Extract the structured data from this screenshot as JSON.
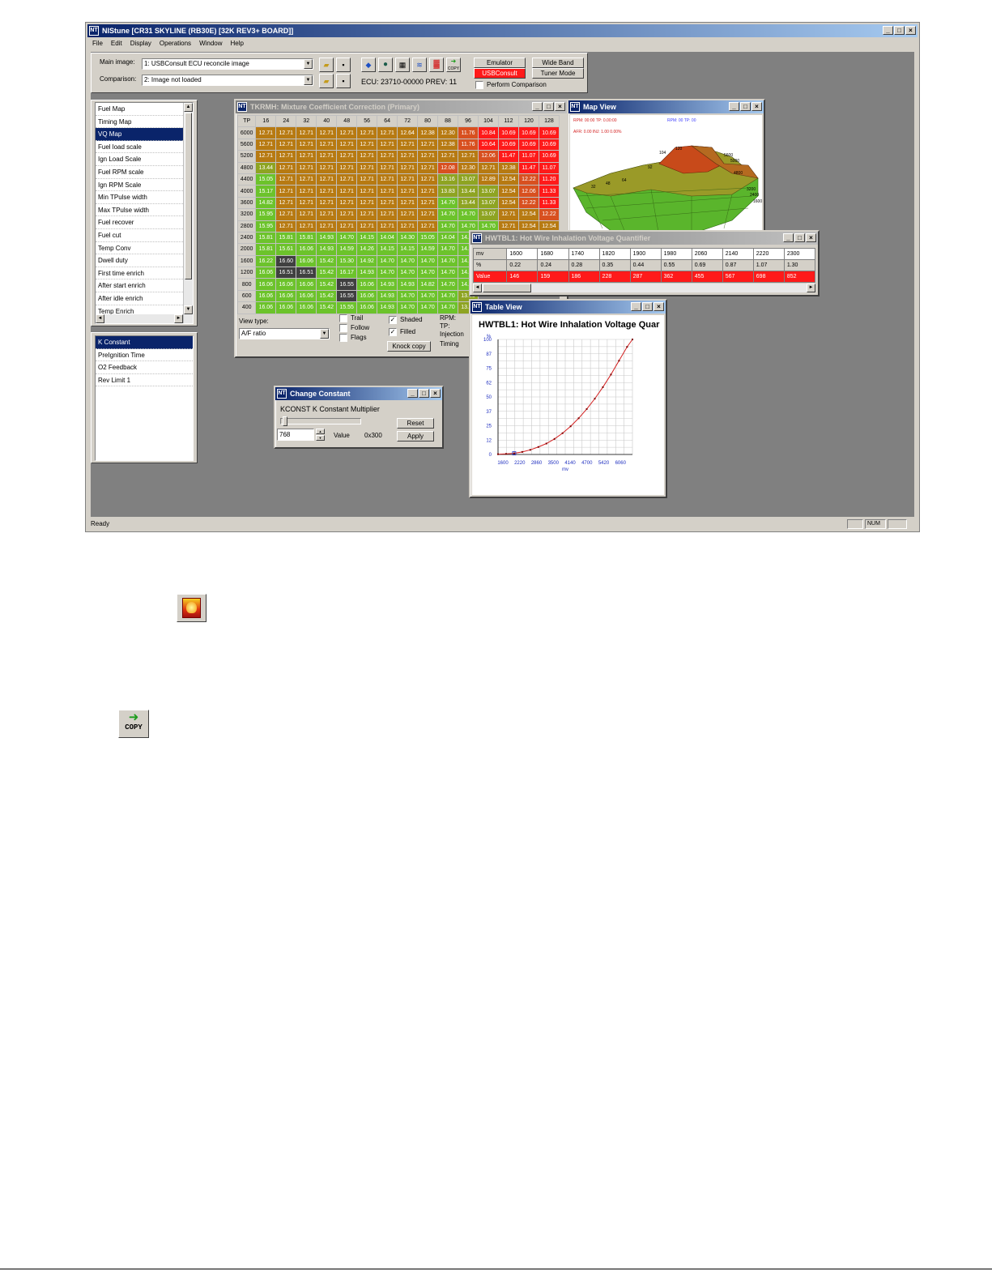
{
  "app": {
    "title": "NIStune [CR31 SKYLINE (RB30E) [32K REV3+ BOARD]]",
    "menu": [
      "File",
      "Edit",
      "Display",
      "Operations",
      "Window",
      "Help"
    ],
    "status": "Ready",
    "status_num": "NUM"
  },
  "toolbar": {
    "main_image_label": "Main image:",
    "main_image_value": "1: USBConsult ECU reconcile image",
    "comparison_label": "Comparison:",
    "comparison_value": "2: Image not loaded",
    "ecu_info": "ECU: 23710-00000 PREV: 11",
    "emulator": "Emulator",
    "usbconsult": "USBConsult",
    "wide_band": "Wide Band",
    "tuner_mode": "Tuner Mode",
    "perform_comparison": "Perform Comparison",
    "copy_label": "COPY"
  },
  "maps_list": [
    "Fuel Map",
    "Timing Map",
    "VQ Map",
    "Fuel load scale",
    "Ign Load Scale",
    "Fuel RPM scale",
    "Ign RPM Scale",
    "Min TPulse width",
    "Max TPulse width",
    "Fuel recover",
    "Fuel cut",
    "Temp Conv",
    "Dwell duty",
    "First time enrich",
    "After start enrich",
    "After idle enrich",
    "Temp Enrich"
  ],
  "maps_selected": 2,
  "constants_list": [
    "K Constant",
    "PreIgnition Time",
    "O2 Feedback",
    "Rev Limit 1"
  ],
  "constants_selected": 0,
  "tkrmh": {
    "title": "TKRMH: Mixture Coefficient Correction (Primary)",
    "corner": "TP",
    "cols": [
      "16",
      "24",
      "32",
      "40",
      "48",
      "56",
      "64",
      "72",
      "80",
      "88",
      "96",
      "104",
      "112",
      "120",
      "128"
    ],
    "rows": [
      {
        "rpm": "6000",
        "v": [
          "12.71",
          "12.71",
          "12.71",
          "12.71",
          "12.71",
          "12.71",
          "12.71",
          "12.64",
          "12.38",
          "12.30",
          "11.76",
          "10.84",
          "10.69",
          "10.69",
          "10.69"
        ]
      },
      {
        "rpm": "5600",
        "v": [
          "12.71",
          "12.71",
          "12.71",
          "12.71",
          "12.71",
          "12.71",
          "12.71",
          "12.71",
          "12.71",
          "12.38",
          "11.76",
          "10.64",
          "10.69",
          "10.69",
          "10.69"
        ]
      },
      {
        "rpm": "5200",
        "v": [
          "12.71",
          "12.71",
          "12.71",
          "12.71",
          "12.71",
          "12.71",
          "12.71",
          "12.71",
          "12.71",
          "12.71",
          "12.71",
          "12.06",
          "11.47",
          "11.07",
          "10.69"
        ]
      },
      {
        "rpm": "4800",
        "v": [
          "13.44",
          "12.71",
          "12.71",
          "12.71",
          "12.71",
          "12.71",
          "12.71",
          "12.71",
          "12.71",
          "12.08",
          "12.30",
          "12.71",
          "12.38",
          "11.47",
          "11.07"
        ]
      },
      {
        "rpm": "4400",
        "v": [
          "15.05",
          "12.71",
          "12.71",
          "12.71",
          "12.71",
          "12.71",
          "12.71",
          "12.71",
          "12.71",
          "13.16",
          "13.07",
          "12.89",
          "12.54",
          "12.22",
          "11.20"
        ]
      },
      {
        "rpm": "4000",
        "v": [
          "15.17",
          "12.71",
          "12.71",
          "12.71",
          "12.71",
          "12.71",
          "12.71",
          "12.71",
          "12.71",
          "13.83",
          "13.44",
          "13.07",
          "12.54",
          "12.06",
          "11.33"
        ]
      },
      {
        "rpm": "3600",
        "v": [
          "14.82",
          "12.71",
          "12.71",
          "12.71",
          "12.71",
          "12.71",
          "12.71",
          "12.71",
          "12.71",
          "14.70",
          "13.44",
          "13.07",
          "12.54",
          "12.22",
          "11.33"
        ]
      },
      {
        "rpm": "3200",
        "v": [
          "15.95",
          "12.71",
          "12.71",
          "12.71",
          "12.71",
          "12.71",
          "12.71",
          "12.71",
          "12.71",
          "14.70",
          "14.70",
          "13.07",
          "12.71",
          "12.54",
          "12.22"
        ]
      },
      {
        "rpm": "2800",
        "v": [
          "15.95",
          "12.71",
          "12.71",
          "12.71",
          "12.71",
          "12.71",
          "12.71",
          "12.71",
          "12.71",
          "14.70",
          "14.70",
          "14.70",
          "12.71",
          "12.54",
          "12.54"
        ]
      },
      {
        "rpm": "2400",
        "v": [
          "15.81",
          "15.81",
          "15.81",
          "14.93",
          "14.70",
          "14.15",
          "14.04",
          "14.30",
          "15.05",
          "14.04",
          "14.70"
        ]
      },
      {
        "rpm": "2000",
        "v": [
          "15.81",
          "15.61",
          "16.06",
          "14.93",
          "14.59",
          "14.26",
          "14.15",
          "14.15",
          "14.59",
          "14.70",
          "14.70"
        ]
      },
      {
        "rpm": "1600",
        "v": [
          "16.22",
          "16.60",
          "16.06",
          "15.42",
          "15.30",
          "14.92",
          "14.70",
          "14.70",
          "14.70",
          "14.70",
          "14.70"
        ]
      },
      {
        "rpm": "1200",
        "v": [
          "16.06",
          "16.51",
          "16.51",
          "15.42",
          "16.17",
          "14.93",
          "14.70",
          "14.70",
          "14.70",
          "14.70",
          "14.70"
        ]
      },
      {
        "rpm": "800",
        "v": [
          "16.06",
          "16.06",
          "16.06",
          "15.42",
          "16.55",
          "16.06",
          "14.93",
          "14.93",
          "14.82",
          "14.70",
          "14.70"
        ]
      },
      {
        "rpm": "600",
        "v": [
          "16.06",
          "16.06",
          "16.06",
          "15.42",
          "16.55",
          "16.06",
          "14.93",
          "14.70",
          "14.70",
          "14.70",
          "13.83"
        ]
      },
      {
        "rpm": "400",
        "v": [
          "16.06",
          "16.06",
          "16.06",
          "15.42",
          "15.55",
          "16.06",
          "14.93",
          "14.70",
          "14.70",
          "14.70",
          "13.83"
        ]
      }
    ],
    "view_type_label": "View type:",
    "view_type_value": "A/F ratio",
    "trail": "Trail",
    "follow": "Follow",
    "flags": "Flags",
    "shaded": "Shaded",
    "filled": "Filled",
    "knock_copy": "Knock copy",
    "rpm": "RPM:",
    "tp": "TP:",
    "injection": "Injection",
    "timing": "Timing"
  },
  "mapview": {
    "title": "Map View",
    "line1a": "RPM: 00:00 TP: 0.00:00",
    "line1b": "RPM: 00 TP: 00",
    "line2": "AFR: 0.00 INJ: 1.00 0.00%",
    "labels": [
      "104",
      "120",
      "5600",
      "5000",
      "92",
      "4800",
      "48",
      "64",
      "32",
      "3200",
      "2400",
      "1600"
    ]
  },
  "hwtbl": {
    "title": "HWTBL1: Hot Wire Inhalation Voltage Quantifier",
    "mv_label": "mv",
    "pct_label": "%",
    "value_label": "Value",
    "mv": [
      "1600",
      "1680",
      "1740",
      "1820",
      "1900",
      "1980",
      "2060",
      "2140",
      "2220",
      "2300"
    ],
    "pct": [
      "0.22",
      "0.24",
      "0.28",
      "0.35",
      "0.44",
      "0.55",
      "0.69",
      "0.87",
      "1.07",
      "1.30"
    ],
    "values": [
      "146",
      "159",
      "186",
      "228",
      "287",
      "362",
      "455",
      "567",
      "698",
      "852"
    ]
  },
  "tableview": {
    "title": "Table View",
    "chart_title": "HWTBL1: Hot Wire Inhalation Voltage Quar",
    "ylabel": "%",
    "xlabel": "mv"
  },
  "chart_data": {
    "type": "line",
    "title": "HWTBL1: Hot Wire Inhalation Voltage Quar",
    "xlabel": "mv",
    "ylabel": "%",
    "x_ticks": [
      "1600",
      "2220",
      "2860",
      "3500",
      "4140",
      "4700",
      "5420",
      "6060"
    ],
    "y_ticks": [
      "0",
      "12",
      "25",
      "37",
      "50",
      "62",
      "75",
      "87",
      "100"
    ],
    "xlim": [
      1600,
      6600
    ],
    "ylim": [
      0,
      100
    ],
    "grid": true,
    "x": [
      1600,
      1900,
      2200,
      2500,
      2800,
      3100,
      3400,
      3700,
      4000,
      4300,
      4600,
      4900,
      5200,
      5500,
      5800,
      6100,
      6400,
      6600
    ],
    "y": [
      0.22,
      0.5,
      1.0,
      2.2,
      4.0,
      6.5,
      9.5,
      13.5,
      18.5,
      24.5,
      31.5,
      39.5,
      48.5,
      58.5,
      69.5,
      81.5,
      93.5,
      100
    ]
  },
  "change_constant": {
    "title": "Change Constant",
    "label": "KCONST K Constant Multiplier",
    "value": "768",
    "value_label": "Value",
    "hex": "0x300",
    "reset": "Reset",
    "apply": "Apply"
  },
  "colors": {
    "selection": "#0a246a",
    "red": "#ff1a1a",
    "green": "#6cc32b",
    "brown": "#b77a12"
  }
}
